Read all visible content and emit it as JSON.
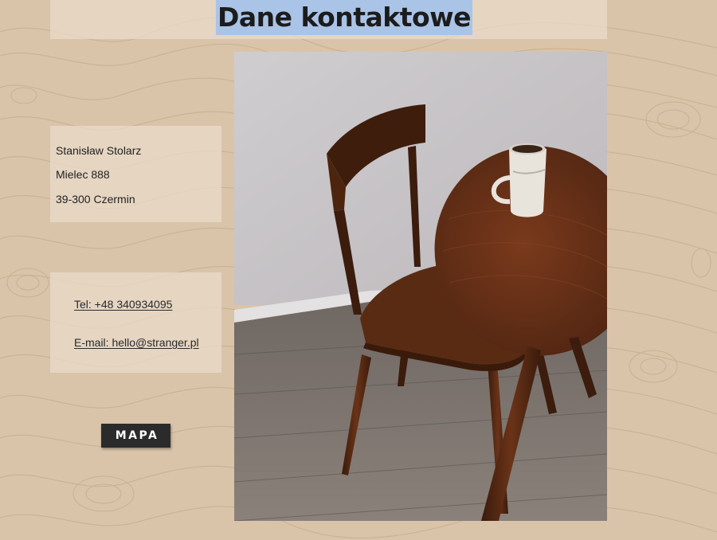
{
  "page": {
    "title": "Dane kontaktowe"
  },
  "address": {
    "name": "Stanisław Stolarz",
    "street": "Mielec 888",
    "city": "39-300 Czermin"
  },
  "contact": {
    "phone_label": "Tel: +48 340934095",
    "email_label": "E-mail: hello@stranger.pl"
  },
  "map_button": {
    "label": "MAPA"
  },
  "photo": {
    "icon": "wooden-chair-table-photo"
  },
  "colors": {
    "background": "#d9c4a9",
    "card": "#e8dac8",
    "title_highlight": "#aac4e8",
    "button": "#2b2b2b"
  }
}
